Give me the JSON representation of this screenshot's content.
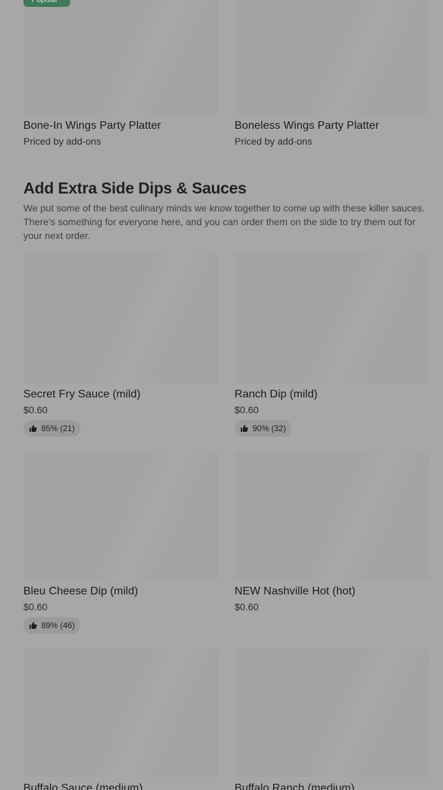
{
  "platters": [
    {
      "title": "Bone-In Wings Party Platter",
      "sub": "Priced by add-ons",
      "tag": "Popular"
    },
    {
      "title": "Boneless Wings Party Platter",
      "sub": "Priced by add-ons"
    }
  ],
  "section": {
    "title": "Add Extra Side Dips & Sauces",
    "description": "We put some of the best culinary minds we know together to come up with these killer sauces. There's something for everyone here, and you can order them on the side to try them out for your next order."
  },
  "items": [
    {
      "title": "Secret Fry Sauce (mild)",
      "price": "$0.60",
      "rating": "85% (21)"
    },
    {
      "title": "Ranch Dip (mild)",
      "price": "$0.60",
      "rating": "90% (32)"
    },
    {
      "title": "Bleu Cheese Dip (mild)",
      "price": "$0.60",
      "rating": "89% (46)"
    },
    {
      "title": "NEW Nashville Hot (hot)",
      "price": "$0.60"
    },
    {
      "title": "Buffalo Sauce (medium)"
    },
    {
      "title": "Buffalo Ranch (medium)"
    }
  ],
  "icons": {
    "rating": "thumbs-up-icon"
  }
}
